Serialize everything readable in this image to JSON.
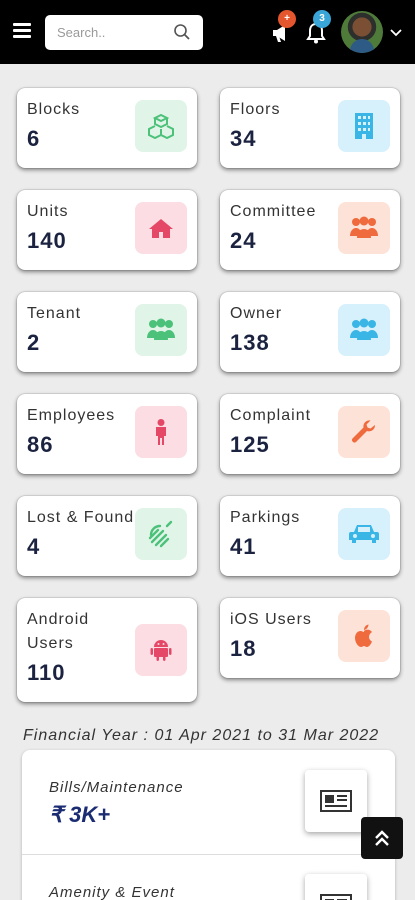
{
  "topbar": {
    "menu_icon": "hamburger-icon",
    "search_placeholder": "Search..",
    "search_icon": "search-icon",
    "notifications": [
      {
        "icon": "megaphone-icon",
        "badge": "+",
        "badge_color": "#e4572e"
      },
      {
        "icon": "bell-icon",
        "badge": "3",
        "badge_color": "#3aa6d8"
      }
    ],
    "avatar_icon": "user-avatar",
    "dropdown_icon": "chevron-down-icon"
  },
  "stats": [
    {
      "label": "Blocks",
      "value": "6",
      "icon": "cubes-icon",
      "icon_color": "#4cc17a",
      "icon_bg": "#e0f5e8"
    },
    {
      "label": "Floors",
      "value": "34",
      "icon": "building-icon",
      "icon_color": "#39b6e6",
      "icon_bg": "#d6f1fb"
    },
    {
      "label": "Units",
      "value": "140",
      "icon": "home-icon",
      "icon_color": "#e54866",
      "icon_bg": "#fbdde3"
    },
    {
      "label": "Committee",
      "value": "24",
      "icon": "group-icon",
      "icon_color": "#ef6a3c",
      "icon_bg": "#fde2d8"
    },
    {
      "label": "Tenant",
      "value": "2",
      "icon": "users-icon",
      "icon_color": "#4cc17a",
      "icon_bg": "#e0f5e8"
    },
    {
      "label": "Owner",
      "value": "138",
      "icon": "users-icon",
      "icon_color": "#39b6e6",
      "icon_bg": "#d6f1fb"
    },
    {
      "label": "Employees",
      "value": "86",
      "icon": "person-icon",
      "icon_color": "#e54866",
      "icon_bg": "#fbdde3"
    },
    {
      "label": "Complaint",
      "value": "125",
      "icon": "wrench-icon",
      "icon_color": "#ef6a3c",
      "icon_bg": "#fde2d8"
    },
    {
      "label": "Lost & Found",
      "value": "4",
      "icon": "hand-icon",
      "icon_color": "#4cc17a",
      "icon_bg": "#e0f5e8"
    },
    {
      "label": "Parkings",
      "value": "41",
      "icon": "car-icon",
      "icon_color": "#39b6e6",
      "icon_bg": "#d6f1fb"
    },
    {
      "label": "Android Users",
      "value": "110",
      "icon": "android-icon",
      "icon_color": "#e54866",
      "icon_bg": "#fbdde3"
    },
    {
      "label": "iOS Users",
      "value": "18",
      "icon": "apple-icon",
      "icon_color": "#ef6a3c",
      "icon_bg": "#fde2d8"
    }
  ],
  "financial": {
    "year_label": "Financial Year : 01 Apr 2021 to 31 Mar 2022",
    "items": [
      {
        "title": "Bills/Maintenance",
        "amount": "₹ 3K+",
        "icon": "bill-icon"
      },
      {
        "title": "Amenity & Event",
        "icon": "bill-icon"
      }
    ]
  },
  "scroll_top_icon": "double-chevron-up-icon"
}
